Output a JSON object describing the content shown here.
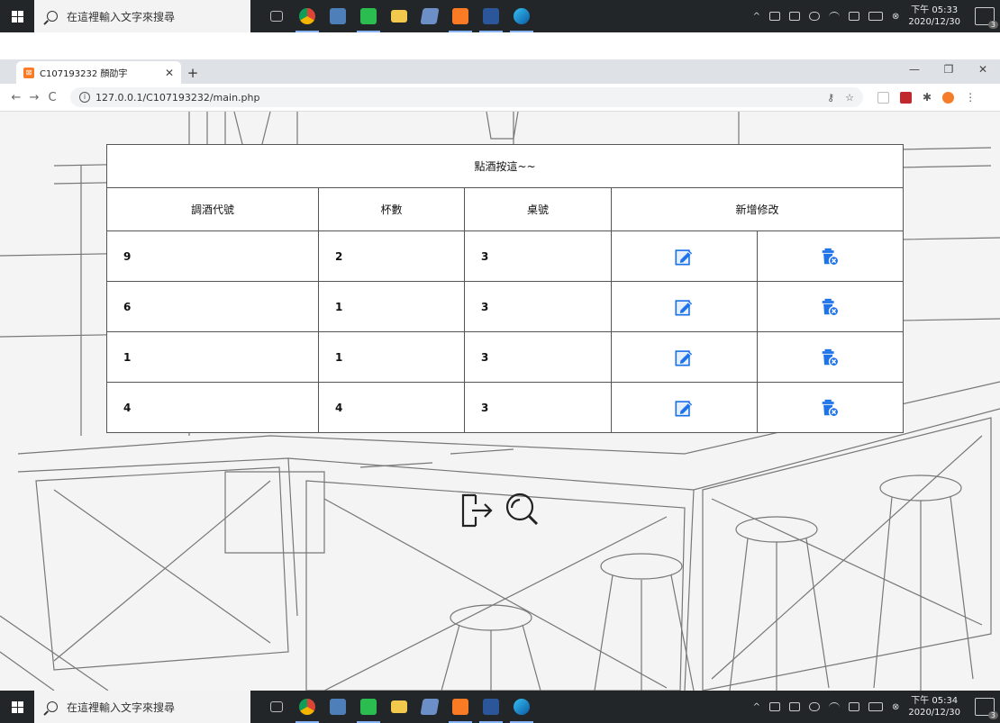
{
  "taskbar": {
    "search_placeholder": "在這裡輸入文字來搜尋",
    "top_clock_line1": "下午 05:33",
    "top_clock_line2": "2020/12/30",
    "bottom_clock_line1": "下午 05:34",
    "bottom_clock_line2": "2020/12/30",
    "notification_count": "3"
  },
  "browser": {
    "tab_title": "C107193232 顏劭宇",
    "url": "127.0.0.1/C107193232/main.php"
  },
  "table": {
    "title": "點酒按這~~",
    "headers": {
      "code": "調酒代號",
      "cups": "杯數",
      "table_no": "桌號",
      "modify": "新增修改"
    },
    "rows": [
      {
        "code": "9",
        "cups": "2",
        "table_no": "3"
      },
      {
        "code": "6",
        "cups": "1",
        "table_no": "3"
      },
      {
        "code": "1",
        "cups": "1",
        "table_no": "3"
      },
      {
        "code": "4",
        "cups": "4",
        "table_no": "3"
      }
    ]
  },
  "colors": {
    "edit_icon": "#1f73e8",
    "delete_icon": "#1f73e8",
    "taskbar_bg": "#222629"
  },
  "icons": {
    "edit": "edit-icon",
    "delete": "trash-delete-icon",
    "logout": "logout-icon",
    "search": "search-icon"
  }
}
